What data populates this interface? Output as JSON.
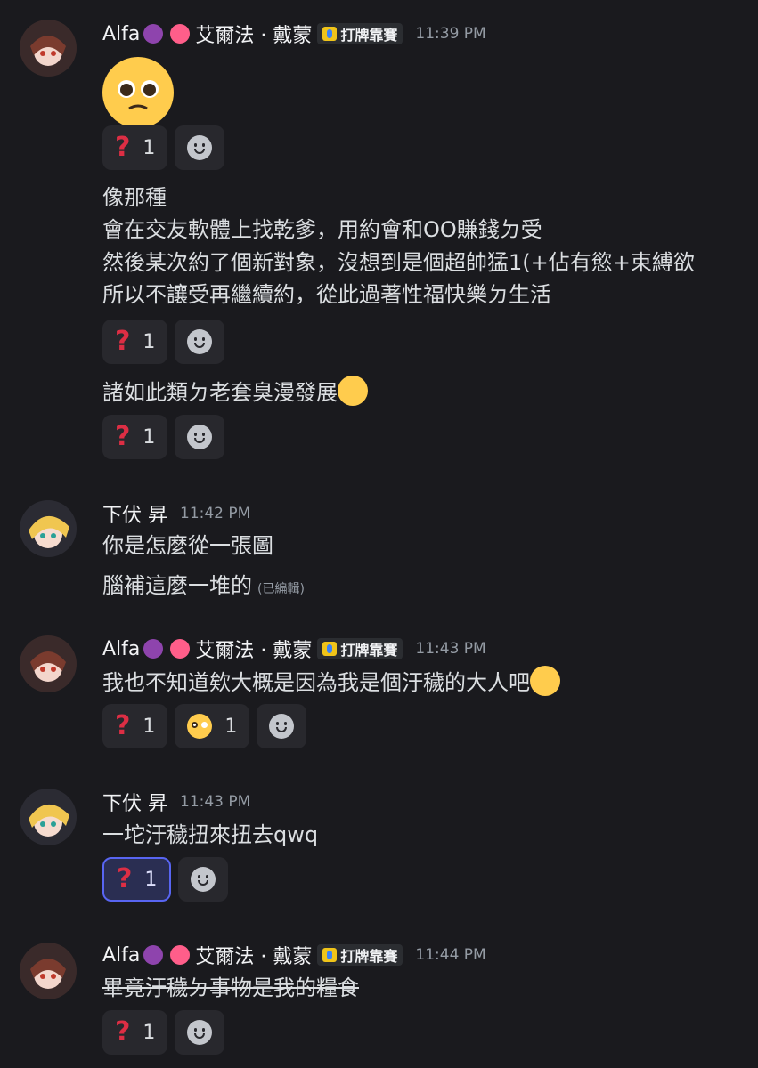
{
  "messages": [
    {
      "author": "Alfa",
      "display": "艾爾法 · 戴蒙",
      "tag": "打牌靠賽",
      "time": "11:39 PM"
    },
    {
      "author": "下伏 昇",
      "time": "11:42 PM"
    },
    {
      "author": "Alfa",
      "display": "艾爾法 · 戴蒙",
      "tag": "打牌靠賽",
      "time": "11:43 PM"
    },
    {
      "author": "下伏 昇",
      "time": "11:43 PM"
    },
    {
      "author": "Alfa",
      "display": "艾爾法 · 戴蒙",
      "tag": "打牌靠賽",
      "time": "11:44 PM"
    }
  ],
  "lines": {
    "l1": "像那種",
    "l2": "會在交友軟體上找乾爹，用約會和OO賺錢ㄉ受",
    "l3": "然後某次約了個新對象，沒想到是個超帥猛1(+佔有慾+束縛欲",
    "l4": "所以不讓受再繼續約，從此過著性福快樂ㄉ生活",
    "l5": "諸如此類ㄉ老套臭漫發展",
    "l6": "你是怎麼從一張圖",
    "l7": "腦補這麼一堆的",
    "edited": "(已編輯)",
    "l8": "我也不知道欸大概是因為我是個汙穢的大人吧",
    "l9": "一坨汙穢扭來扭去qwq",
    "l10": "畢竟汙穢ㄉ事物是我的糧食"
  },
  "reactions": {
    "count": "1"
  },
  "colors": {
    "background": "#1a1a1e",
    "accent": "#5865f2",
    "reaction_bg": "#28282d"
  }
}
